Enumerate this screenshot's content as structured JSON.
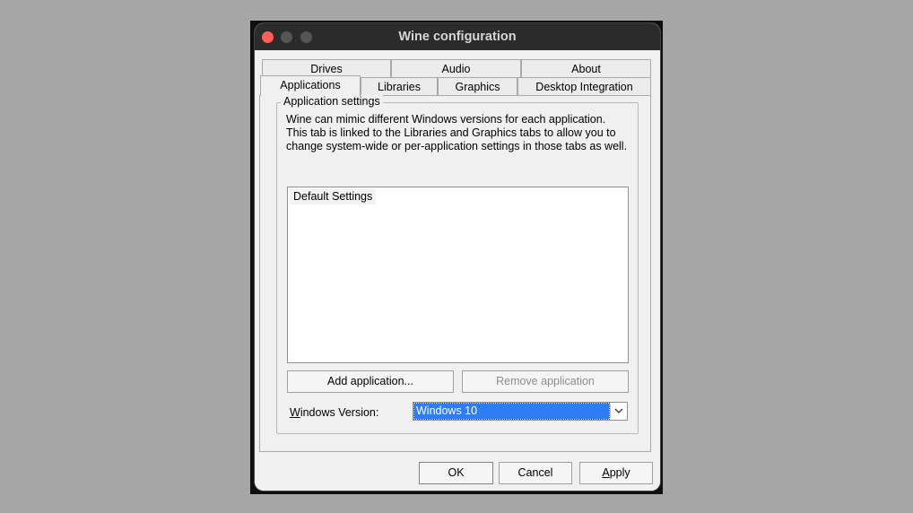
{
  "window": {
    "title": "Wine configuration"
  },
  "tabs": {
    "row_top": [
      {
        "label": "Drives"
      },
      {
        "label": "Audio"
      },
      {
        "label": "About"
      }
    ],
    "row_bottom": [
      {
        "label": "Applications",
        "active": true
      },
      {
        "label": "Libraries"
      },
      {
        "label": "Graphics"
      },
      {
        "label": "Desktop Integration"
      }
    ]
  },
  "app_settings": {
    "group_title": "Application settings",
    "description": [
      "Wine can mimic different Windows versions for each application.",
      "This tab is linked to the Libraries and Graphics tabs to allow you to",
      "change system-wide or per-application settings in those tabs as well."
    ],
    "list_items": [
      "Default Settings"
    ],
    "add_button": "Add application...",
    "remove_button": "Remove application",
    "version_label_first": "W",
    "version_label_rest": "indows Version:",
    "version_value": "Windows 10"
  },
  "footer": {
    "ok": "OK",
    "cancel": "Cancel",
    "apply_first": "A",
    "apply_rest": "pply"
  },
  "colors": {
    "accent": "#2f7df2",
    "close_button": "#ff5f57"
  },
  "icons": {
    "combo_arrow": "chevron-down-icon"
  }
}
